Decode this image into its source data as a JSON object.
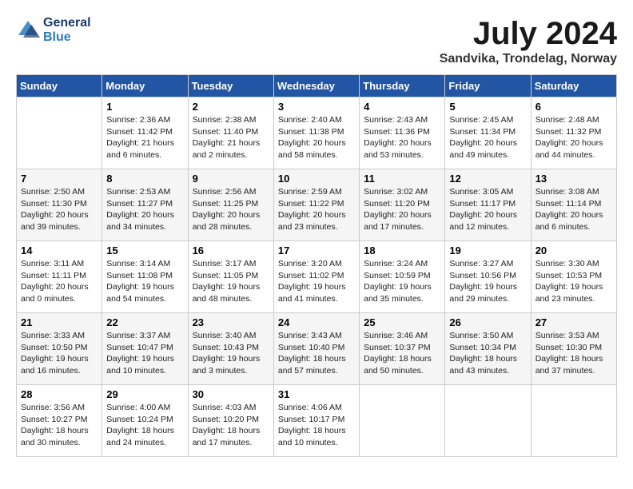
{
  "header": {
    "logo_line1": "General",
    "logo_line2": "Blue",
    "month_title": "July 2024",
    "location": "Sandvika, Trondelag, Norway"
  },
  "days_of_week": [
    "Sunday",
    "Monday",
    "Tuesday",
    "Wednesday",
    "Thursday",
    "Friday",
    "Saturday"
  ],
  "weeks": [
    [
      {
        "day": "",
        "info": ""
      },
      {
        "day": "1",
        "info": "Sunrise: 2:36 AM\nSunset: 11:42 PM\nDaylight: 21 hours\nand 6 minutes."
      },
      {
        "day": "2",
        "info": "Sunrise: 2:38 AM\nSunset: 11:40 PM\nDaylight: 21 hours\nand 2 minutes."
      },
      {
        "day": "3",
        "info": "Sunrise: 2:40 AM\nSunset: 11:38 PM\nDaylight: 20 hours\nand 58 minutes."
      },
      {
        "day": "4",
        "info": "Sunrise: 2:43 AM\nSunset: 11:36 PM\nDaylight: 20 hours\nand 53 minutes."
      },
      {
        "day": "5",
        "info": "Sunrise: 2:45 AM\nSunset: 11:34 PM\nDaylight: 20 hours\nand 49 minutes."
      },
      {
        "day": "6",
        "info": "Sunrise: 2:48 AM\nSunset: 11:32 PM\nDaylight: 20 hours\nand 44 minutes."
      }
    ],
    [
      {
        "day": "7",
        "info": "Sunrise: 2:50 AM\nSunset: 11:30 PM\nDaylight: 20 hours\nand 39 minutes."
      },
      {
        "day": "8",
        "info": "Sunrise: 2:53 AM\nSunset: 11:27 PM\nDaylight: 20 hours\nand 34 minutes."
      },
      {
        "day": "9",
        "info": "Sunrise: 2:56 AM\nSunset: 11:25 PM\nDaylight: 20 hours\nand 28 minutes."
      },
      {
        "day": "10",
        "info": "Sunrise: 2:59 AM\nSunset: 11:22 PM\nDaylight: 20 hours\nand 23 minutes."
      },
      {
        "day": "11",
        "info": "Sunrise: 3:02 AM\nSunset: 11:20 PM\nDaylight: 20 hours\nand 17 minutes."
      },
      {
        "day": "12",
        "info": "Sunrise: 3:05 AM\nSunset: 11:17 PM\nDaylight: 20 hours\nand 12 minutes."
      },
      {
        "day": "13",
        "info": "Sunrise: 3:08 AM\nSunset: 11:14 PM\nDaylight: 20 hours\nand 6 minutes."
      }
    ],
    [
      {
        "day": "14",
        "info": "Sunrise: 3:11 AM\nSunset: 11:11 PM\nDaylight: 20 hours\nand 0 minutes."
      },
      {
        "day": "15",
        "info": "Sunrise: 3:14 AM\nSunset: 11:08 PM\nDaylight: 19 hours\nand 54 minutes."
      },
      {
        "day": "16",
        "info": "Sunrise: 3:17 AM\nSunset: 11:05 PM\nDaylight: 19 hours\nand 48 minutes."
      },
      {
        "day": "17",
        "info": "Sunrise: 3:20 AM\nSunset: 11:02 PM\nDaylight: 19 hours\nand 41 minutes."
      },
      {
        "day": "18",
        "info": "Sunrise: 3:24 AM\nSunset: 10:59 PM\nDaylight: 19 hours\nand 35 minutes."
      },
      {
        "day": "19",
        "info": "Sunrise: 3:27 AM\nSunset: 10:56 PM\nDaylight: 19 hours\nand 29 minutes."
      },
      {
        "day": "20",
        "info": "Sunrise: 3:30 AM\nSunset: 10:53 PM\nDaylight: 19 hours\nand 23 minutes."
      }
    ],
    [
      {
        "day": "21",
        "info": "Sunrise: 3:33 AM\nSunset: 10:50 PM\nDaylight: 19 hours\nand 16 minutes."
      },
      {
        "day": "22",
        "info": "Sunrise: 3:37 AM\nSunset: 10:47 PM\nDaylight: 19 hours\nand 10 minutes."
      },
      {
        "day": "23",
        "info": "Sunrise: 3:40 AM\nSunset: 10:43 PM\nDaylight: 19 hours\nand 3 minutes."
      },
      {
        "day": "24",
        "info": "Sunrise: 3:43 AM\nSunset: 10:40 PM\nDaylight: 18 hours\nand 57 minutes."
      },
      {
        "day": "25",
        "info": "Sunrise: 3:46 AM\nSunset: 10:37 PM\nDaylight: 18 hours\nand 50 minutes."
      },
      {
        "day": "26",
        "info": "Sunrise: 3:50 AM\nSunset: 10:34 PM\nDaylight: 18 hours\nand 43 minutes."
      },
      {
        "day": "27",
        "info": "Sunrise: 3:53 AM\nSunset: 10:30 PM\nDaylight: 18 hours\nand 37 minutes."
      }
    ],
    [
      {
        "day": "28",
        "info": "Sunrise: 3:56 AM\nSunset: 10:27 PM\nDaylight: 18 hours\nand 30 minutes."
      },
      {
        "day": "29",
        "info": "Sunrise: 4:00 AM\nSunset: 10:24 PM\nDaylight: 18 hours\nand 24 minutes."
      },
      {
        "day": "30",
        "info": "Sunrise: 4:03 AM\nSunset: 10:20 PM\nDaylight: 18 hours\nand 17 minutes."
      },
      {
        "day": "31",
        "info": "Sunrise: 4:06 AM\nSunset: 10:17 PM\nDaylight: 18 hours\nand 10 minutes."
      },
      {
        "day": "",
        "info": ""
      },
      {
        "day": "",
        "info": ""
      },
      {
        "day": "",
        "info": ""
      }
    ]
  ]
}
